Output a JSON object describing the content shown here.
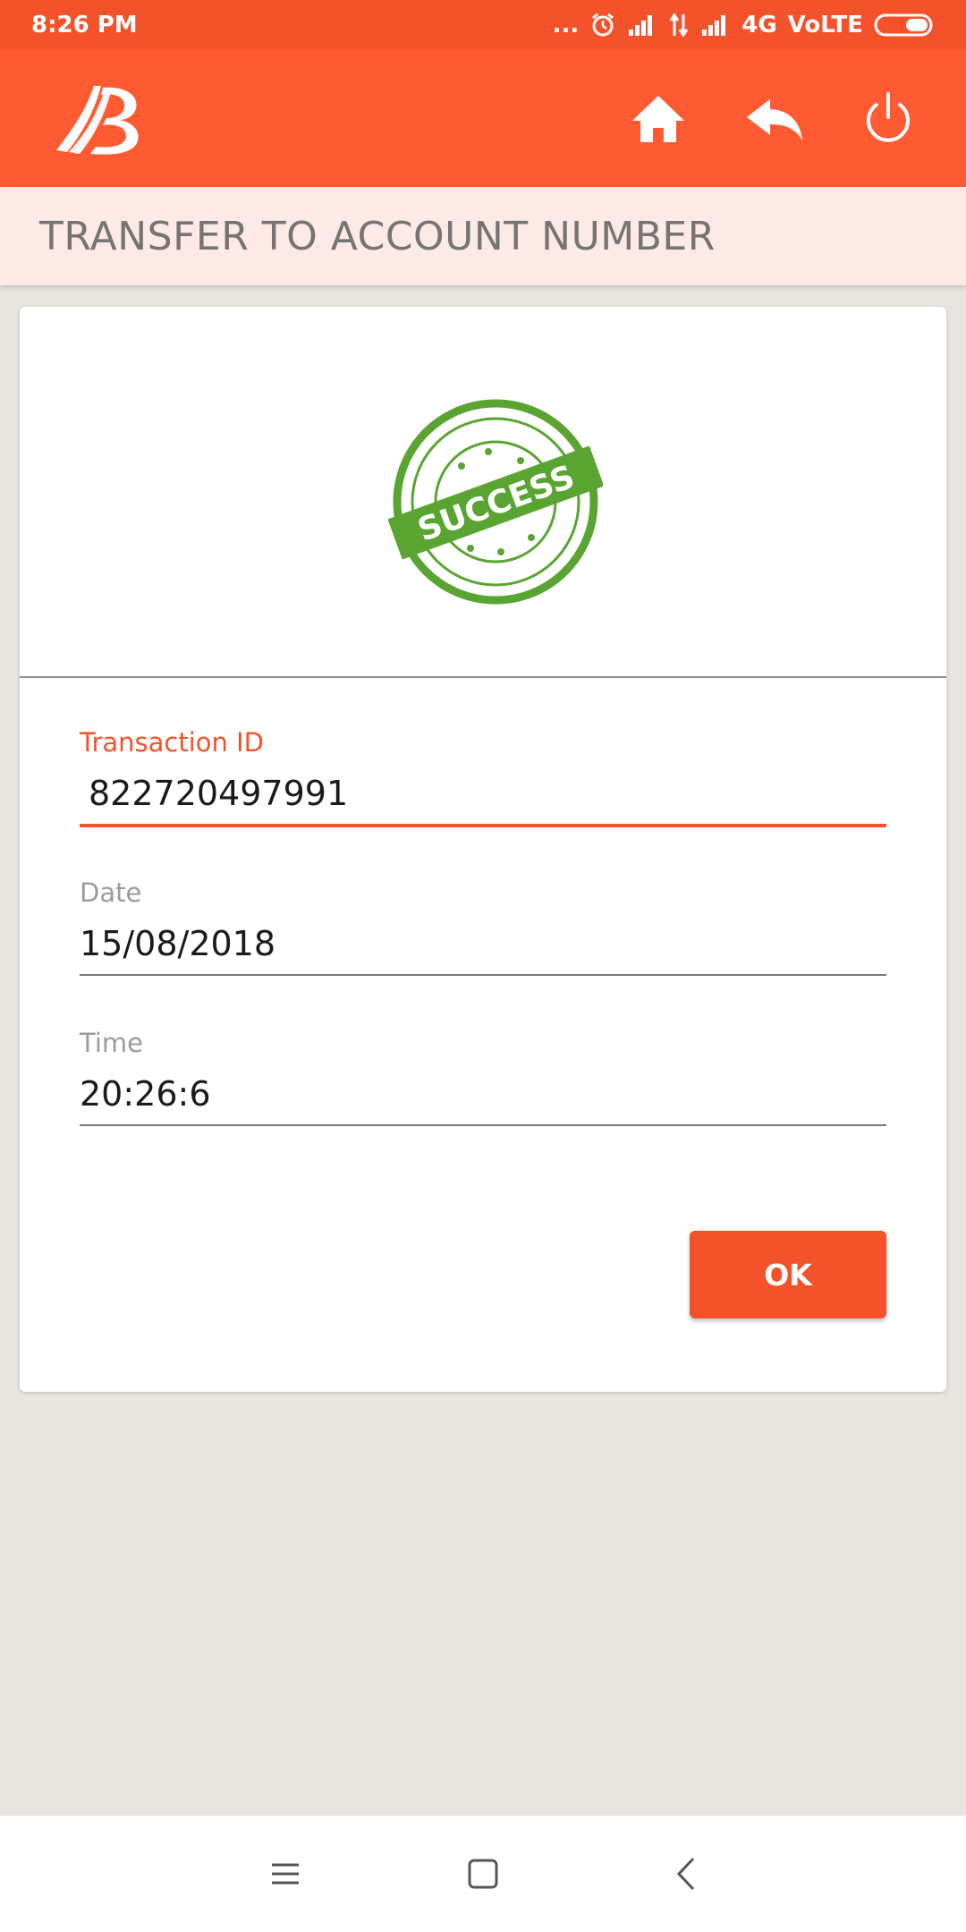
{
  "status_bar": {
    "time": "8:26 PM",
    "dots": "...",
    "network_label": "4G",
    "volte_label": "VoLTE",
    "icons": [
      "alarm-icon",
      "signal-icon",
      "data-arrows-icon",
      "signal-icon",
      "battery-icon"
    ]
  },
  "app_bar": {
    "logo": "bank-logo",
    "icons": [
      "home-icon",
      "back-arrow-icon",
      "power-icon"
    ]
  },
  "page": {
    "title": "TRANSFER TO ACCOUNT NUMBER"
  },
  "result": {
    "stamp_text": "SUCCESS"
  },
  "fields": [
    {
      "label": "Transaction ID",
      "value": "822720497991"
    },
    {
      "label": "Date",
      "value": "15/08/2018"
    },
    {
      "label": "Time",
      "value": "20:26:6"
    }
  ],
  "actions": {
    "ok_label": "OK"
  },
  "nav_bar": {
    "icons": [
      "menu-icon",
      "home-square-icon",
      "back-chevron-icon"
    ]
  },
  "colors": {
    "accent": "#f4522b",
    "app_bar": "#ff5a31",
    "title_bar": "#fdeae6",
    "success_green": "#5aa532",
    "background": "#e8e5e1"
  }
}
